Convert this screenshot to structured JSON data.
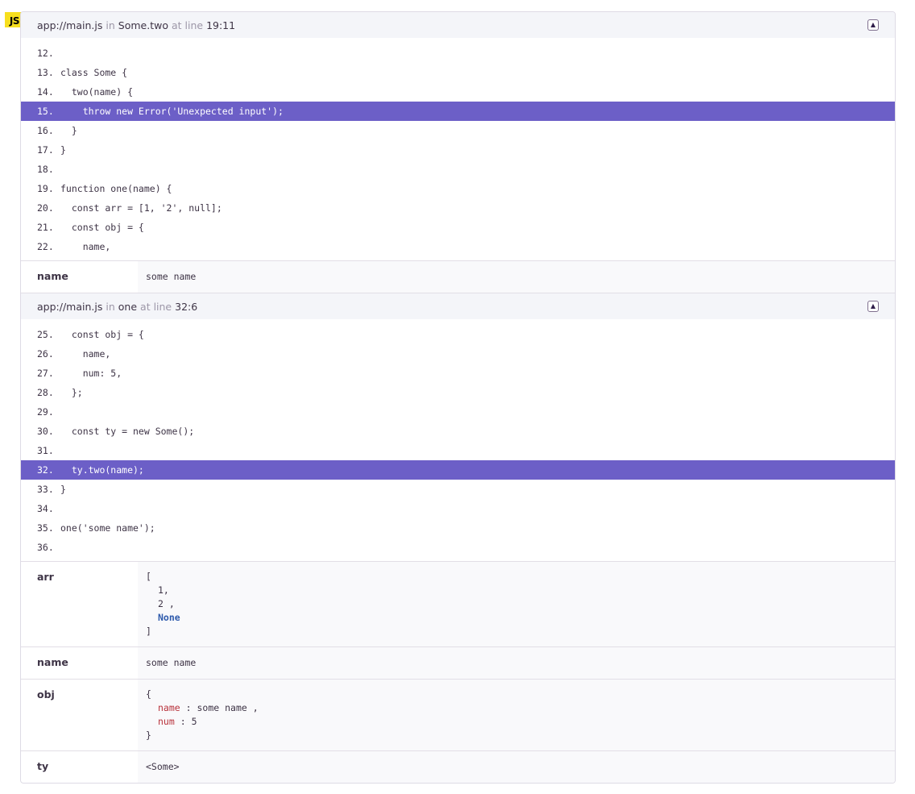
{
  "badge": "JS",
  "frames": [
    {
      "file": "app://main.js",
      "in_label": "in",
      "function": "Some.two",
      "at_line_label": "at line",
      "location": "19:11",
      "toggle_glyph": "^",
      "lines": [
        {
          "n": "12.",
          "code": ""
        },
        {
          "n": "13.",
          "code": "class Some {"
        },
        {
          "n": "14.",
          "code": "  two(name) {"
        },
        {
          "n": "15.",
          "code": "    throw new Error('Unexpected input');"
        },
        {
          "n": "16.",
          "code": "  }"
        },
        {
          "n": "17.",
          "code": "}"
        },
        {
          "n": "18.",
          "code": ""
        },
        {
          "n": "19.",
          "code": "function one(name) {"
        },
        {
          "n": "20.",
          "code": "  const arr = [1, '2', null];"
        },
        {
          "n": "21.",
          "code": "  const obj = {"
        },
        {
          "n": "22.",
          "code": "    name,"
        }
      ],
      "vars": [
        {
          "key": "name",
          "value": "some name"
        }
      ]
    },
    {
      "file": "app://main.js",
      "in_label": "in",
      "function": "one",
      "at_line_label": "at line",
      "location": "32:6",
      "toggle_glyph": "^",
      "lines": [
        {
          "n": "25.",
          "code": "  const obj = {"
        },
        {
          "n": "26.",
          "code": "    name,"
        },
        {
          "n": "27.",
          "code": "    num: 5,"
        },
        {
          "n": "28.",
          "code": "  };"
        },
        {
          "n": "29.",
          "code": ""
        },
        {
          "n": "30.",
          "code": "  const ty = new Some();"
        },
        {
          "n": "31.",
          "code": ""
        },
        {
          "n": "32.",
          "code": "  ty.two(name);"
        },
        {
          "n": "33.",
          "code": "}"
        },
        {
          "n": "34.",
          "code": ""
        },
        {
          "n": "35.",
          "code": "one('some name');"
        },
        {
          "n": "36.",
          "code": ""
        }
      ],
      "vars": {
        "arr": {
          "key": "arr",
          "open": "[",
          "items": [
            "1,",
            "2 ,",
            "None"
          ],
          "close": "]"
        },
        "name": {
          "key": "name",
          "value": "some name"
        },
        "obj": {
          "key": "obj",
          "open": "{",
          "entries": [
            {
              "k": "name",
              "sep": " : ",
              "v": "some name ,"
            },
            {
              "k": "num",
              "sep": " : ",
              "v": "5"
            }
          ],
          "close": "}"
        },
        "ty": {
          "key": "ty",
          "value": "<Some>"
        }
      }
    }
  ],
  "colors": {
    "highlight": "#6c5fc7",
    "badge": "#f7df1e",
    "none_value": "#2e5aac",
    "object_key": "#b8323b"
  },
  "active_line_numbers": [
    "15.",
    "32."
  ]
}
